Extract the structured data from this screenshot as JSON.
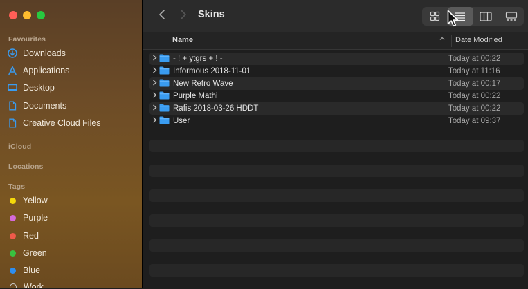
{
  "window": {
    "title": "Skins"
  },
  "sidebar": {
    "favourites_label": "Favourites",
    "favourites": [
      {
        "label": "Downloads",
        "icon": "download-icon"
      },
      {
        "label": "Applications",
        "icon": "applications-icon"
      },
      {
        "label": "Desktop",
        "icon": "desktop-icon"
      },
      {
        "label": "Documents",
        "icon": "document-icon"
      },
      {
        "label": "Creative Cloud Files",
        "icon": "document-icon"
      }
    ],
    "icloud_label": "iCloud",
    "locations_label": "Locations",
    "tags_label": "Tags",
    "tags": [
      {
        "label": "Yellow",
        "color": "#f5d90a"
      },
      {
        "label": "Purple",
        "color": "#d56ad9"
      },
      {
        "label": "Red",
        "color": "#ef5a4a"
      },
      {
        "label": "Green",
        "color": "#39c23f"
      },
      {
        "label": "Blue",
        "color": "#2e8ef0"
      },
      {
        "label": "Work",
        "color": "#cccccc"
      }
    ],
    "accent_color": "#3a9cf0"
  },
  "table": {
    "header_name": "Name",
    "header_date": "Date Modified",
    "rows": [
      {
        "name": "- ! + ytgrs + ! -",
        "date": "Today at 00:22"
      },
      {
        "name": "Informous 2018-11-01",
        "date": "Today at 11:16"
      },
      {
        "name": "New Retro Wave",
        "date": "Today at 00:17"
      },
      {
        "name": "Purple Mathi",
        "date": "Today at 00:22"
      },
      {
        "name": "Rafis 2018-03-26 HDDT",
        "date": "Today at 00:22"
      },
      {
        "name": "User",
        "date": "Today at 09:37"
      }
    ]
  },
  "toolbar": {
    "views": [
      "icon-view",
      "list-view",
      "column-view",
      "gallery-view"
    ],
    "active_view": "list-view"
  }
}
